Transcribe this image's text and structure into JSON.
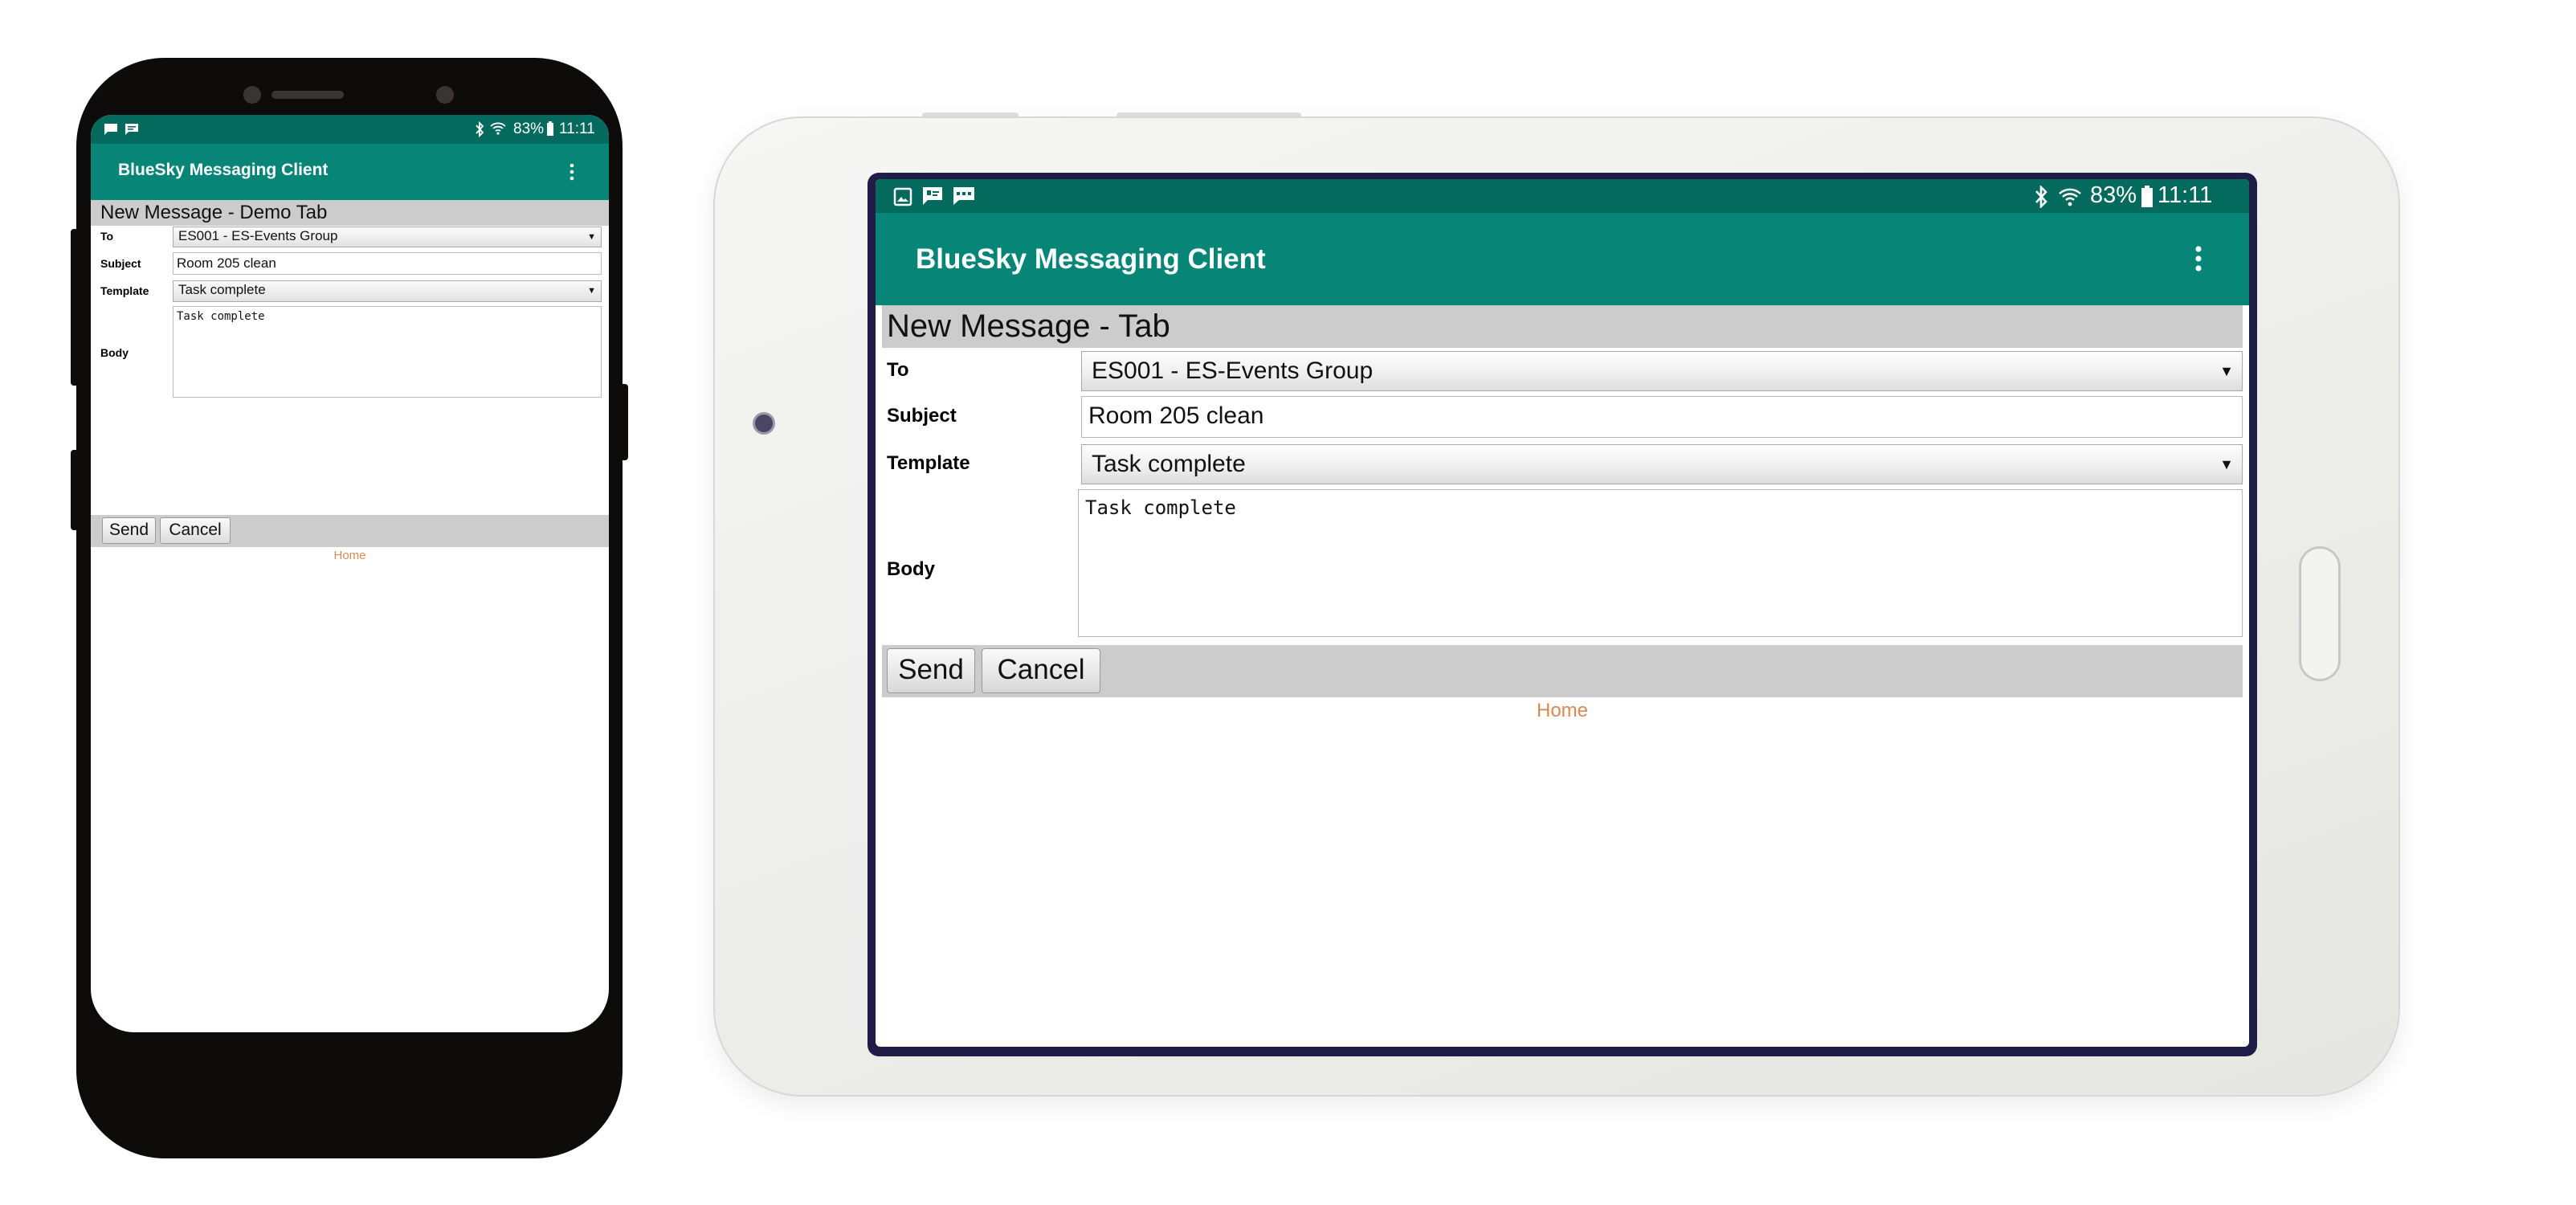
{
  "colors": {
    "status_bar": "#046a5e",
    "app_bar": "#078677",
    "title_bar": "#cccccc",
    "home_link": "#d98a52"
  },
  "phone": {
    "status": {
      "left_icons": [
        "message-icon",
        "chat-icon"
      ],
      "right_icons": [
        "bluetooth-icon",
        "wifi-icon",
        "battery-icon"
      ],
      "battery": "83%",
      "time": "11:11"
    },
    "app_title": "BlueSky Messaging Client",
    "menu_icon": "overflow-menu-icon",
    "page_title": "New Message - Demo Tab",
    "form": {
      "to_label": "To",
      "to_value": "ES001 - ES-Events Group",
      "subject_label": "Subject",
      "subject_value": "Room 205 clean",
      "template_label": "Template",
      "template_value": "Task complete",
      "body_label": "Body",
      "body_value": "Task complete"
    },
    "send_label": "Send",
    "cancel_label": "Cancel",
    "home_label": "Home"
  },
  "tablet": {
    "status": {
      "left_icons": [
        "image-icon",
        "contact-icon",
        "sms-icon"
      ],
      "right_icons": [
        "bluetooth-icon",
        "wifi-icon",
        "battery-icon"
      ],
      "battery": "83%",
      "time": "11:11"
    },
    "app_title": "BlueSky Messaging Client",
    "menu_icon": "overflow-menu-icon",
    "page_title": "New Message - Tab",
    "form": {
      "to_label": "To",
      "to_value": "ES001 - ES-Events Group",
      "subject_label": "Subject",
      "subject_value": "Room 205 clean",
      "template_label": "Template",
      "template_value": "Task complete",
      "body_label": "Body",
      "body_value": "Task complete"
    },
    "send_label": "Send",
    "cancel_label": "Cancel",
    "home_label": "Home"
  }
}
